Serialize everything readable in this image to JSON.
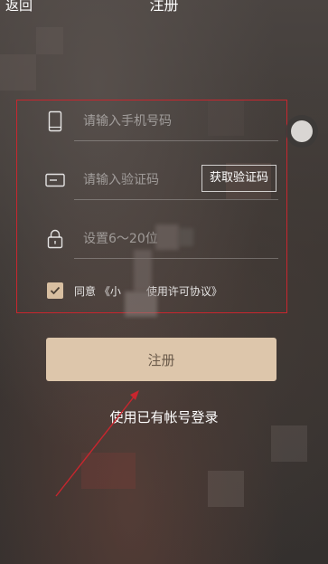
{
  "header": {
    "back_label": "返回",
    "title": "注册"
  },
  "form": {
    "phone": {
      "placeholder": "请输入手机号码",
      "icon": "phone-icon"
    },
    "code": {
      "placeholder": "请输入验证码",
      "icon": "card-icon",
      "get_code_label": "获取验证码"
    },
    "password": {
      "placeholder": "设置6～20位",
      "icon": "lock-icon"
    },
    "agreement": {
      "checked": true,
      "prefix": "同意 《小",
      "suffix": "使用许可协议》"
    }
  },
  "actions": {
    "register_label": "注册",
    "login_label": "使用已有帐号登录"
  },
  "colors": {
    "accent": "#ddc6ab",
    "annotation": "#c8262e"
  }
}
